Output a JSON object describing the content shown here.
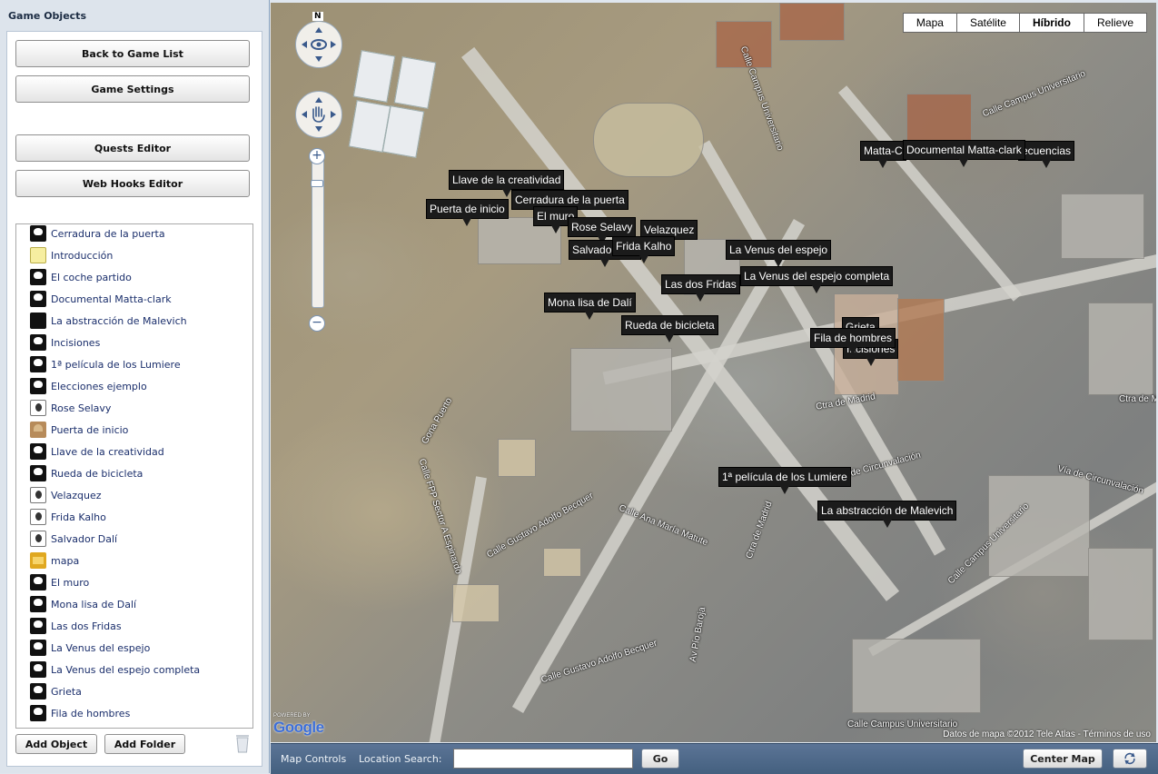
{
  "left_panel": {
    "title": "Game Objects",
    "buttons": {
      "back": "Back to Game List",
      "settings": "Game Settings",
      "quests": "Quests Editor",
      "webhooks": "Web Hooks Editor"
    },
    "objects": [
      {
        "label": "Cerradura de la puerta",
        "icon": "lock-icon"
      },
      {
        "label": "Introducción",
        "icon": "note-icon"
      },
      {
        "label": "El coche partido",
        "icon": "mask-icon"
      },
      {
        "label": "Documental Matta-clark",
        "icon": "mask-icon"
      },
      {
        "label": "La abstracción de Malevich",
        "icon": "black-square-icon"
      },
      {
        "label": "Incisiones",
        "icon": "mask-icon"
      },
      {
        "label": "1ª película de los Lumiere",
        "icon": "mask-icon"
      },
      {
        "label": "Elecciones ejemplo",
        "icon": "mask-icon"
      },
      {
        "label": "Rose Selavy",
        "icon": "portrait-icon"
      },
      {
        "label": "Puerta de inicio",
        "icon": "door-icon"
      },
      {
        "label": "Llave de la creatividad",
        "icon": "key-icon"
      },
      {
        "label": "Rueda de bicicleta",
        "icon": "mask-icon"
      },
      {
        "label": "Velazquez",
        "icon": "portrait-icon"
      },
      {
        "label": "Frida Kalho",
        "icon": "portrait-icon"
      },
      {
        "label": "Salvador Dalí",
        "icon": "portrait-icon"
      },
      {
        "label": "mapa",
        "icon": "box-icon"
      },
      {
        "label": "El muro",
        "icon": "mask-icon"
      },
      {
        "label": "Mona lisa de Dalí",
        "icon": "mask-icon"
      },
      {
        "label": "Las dos Fridas",
        "icon": "mask-icon"
      },
      {
        "label": "La Venus del espejo",
        "icon": "mask-icon"
      },
      {
        "label": "La Venus del espejo completa",
        "icon": "mask-icon"
      },
      {
        "label": "Grieta",
        "icon": "mask-icon"
      },
      {
        "label": "Fila de hombres",
        "icon": "mask-icon"
      }
    ],
    "add_object": "Add Object",
    "add_folder": "Add Folder"
  },
  "map": {
    "map_types": [
      "Mapa",
      "Satélite",
      "Híbrido",
      "Relieve"
    ],
    "active_map_type": "Híbrido",
    "compass": "N",
    "markers": {
      "llave": "Llave de la creatividad",
      "cerradura": "Cerradura de la puerta",
      "puerta": "Puerta de inicio",
      "muro": "El muro",
      "rose": "Rose Selavy",
      "velazquez": "Velazquez",
      "salvador": "Salvador Dalí",
      "frida": "Frida Kalho",
      "venus": "La Venus del espejo",
      "venus_completa": "La Venus del espejo completa",
      "dos_fridas": "Las dos Fridas",
      "mona": "Mona lisa de Dalí",
      "rueda": "Rueda de bicicleta",
      "grieta": "Grieta",
      "fila": "Fila de hombres",
      "incisiones": "Incisiones",
      "matta_c": "Matta-C",
      "documental": "Documental Matta-clark",
      "secuencias": "ecuencias",
      "lumiere": "1ª película de los Lumiere",
      "malevich": "La abstracción de Malevich"
    },
    "streets": {
      "campus_1": "Calle Campus Universitario",
      "campus_2": "Calle Campus Universitario",
      "madrid": "Ctra de Madrid",
      "madrid_2": "Ctra de M",
      "circunvalacion": "Vía de Circunvalación",
      "circunvalacion_2": "Vía de Circunvalación",
      "becquer_1": "Calle Gustavo Adolfo Becquer",
      "becquer_2": "Calle Gustavo Adolfo Becquer",
      "matute": "Calle Ana María Matute",
      "espinardo": "Calle FPP Sector A Espinardo",
      "madrid_ctra": "Ctra de Madrid",
      "pio_baroja": "Av Pío Baroja",
      "campus_3": "Calle Campus Universitario",
      "campus_bottom": "Calle Campus Universitario",
      "gona": "Gona Puerto"
    },
    "powered_by": "POWERED BY",
    "google": "Google",
    "copyright": "Datos de mapa ©2012 Tele Atlas - Términos de uso"
  },
  "bottom_bar": {
    "map_controls": "Map Controls",
    "location_search": "Location Search:",
    "search_value": "",
    "go": "Go",
    "center_map": "Center Map"
  }
}
